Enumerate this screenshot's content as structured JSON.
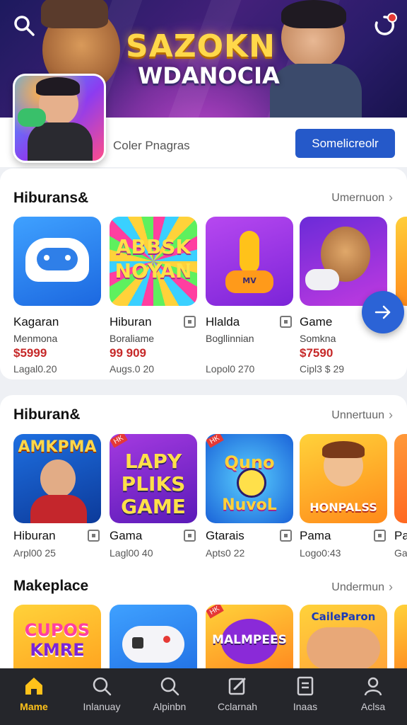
{
  "hero": {
    "title_line1": "SAZOKN",
    "title_line2": "WDANOCIA"
  },
  "feature": {
    "text": "Coler Pnagras",
    "button": "Somelicreolr"
  },
  "section1": {
    "title": "Hiburans&",
    "more": "Umernuon",
    "apps": [
      {
        "name": "Kagaran",
        "sub": "Menmona",
        "price": "$5999",
        "meta": "Lagal0.20"
      },
      {
        "name": "Hiburan",
        "sub": "Boraliame",
        "price": "99 909",
        "meta": "Augs.0 20",
        "art": [
          "ABBSK",
          "NOYAN"
        ]
      },
      {
        "name": "Hlalda",
        "sub": "Bogllinnian",
        "price": "",
        "meta": "Lopol0 270",
        "art_small": "MV"
      },
      {
        "name": "Game",
        "sub": "Somkna",
        "price": "$7590",
        "meta": "Cipl3 $ 29"
      }
    ]
  },
  "section2": {
    "title": "Hiburan&",
    "more": "Unnertuun",
    "apps": [
      {
        "name": "Hiburan",
        "meta": "Arpl00 25",
        "art": [
          "AMKPMA"
        ]
      },
      {
        "name": "Gama",
        "meta": "Lagl00 40",
        "art": [
          "LAPY",
          "PLIKS",
          "GAME"
        ],
        "tag": "HK"
      },
      {
        "name": "Gtarais",
        "meta": "Apts0 22",
        "art": [
          "Quno",
          "NuvoL"
        ],
        "tag": "HK"
      },
      {
        "name": "Pama",
        "meta": "Logo0:43",
        "art": [
          "HONPALSS"
        ]
      },
      {
        "name": "Pa",
        "meta": "Ga"
      }
    ]
  },
  "section3": {
    "title": "Makeplace",
    "more": "Undermun",
    "apps": [
      {
        "art": [
          "CUPOS",
          "KMRE"
        ]
      },
      {
        "art": []
      },
      {
        "art": [
          "MALMPEES"
        ],
        "tag": "HK"
      },
      {
        "art": [
          "CaileParon"
        ]
      }
    ]
  },
  "nav": [
    {
      "label": "Mame",
      "icon": "home-icon",
      "active": true
    },
    {
      "label": "Inlanuay",
      "icon": "search-icon"
    },
    {
      "label": "Alpinbn",
      "icon": "search-icon"
    },
    {
      "label": "Cclarnah",
      "icon": "edit-icon"
    },
    {
      "label": "Inaas",
      "icon": "list-icon"
    },
    {
      "label": "Aclsa",
      "icon": "person-icon"
    }
  ],
  "colors": {
    "accent": "#2559c9",
    "nav_active": "#ffc21a",
    "price": "#c62828"
  }
}
